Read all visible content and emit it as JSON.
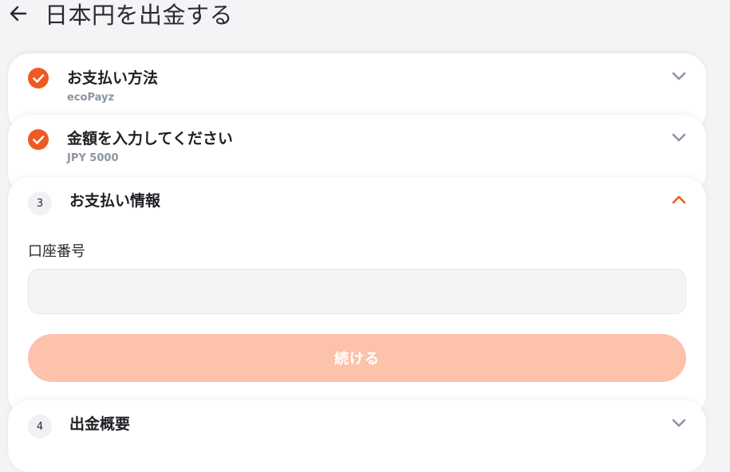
{
  "header": {
    "back_icon": "arrow-left-icon",
    "title": "日本円を出金する"
  },
  "steps": [
    {
      "status": "completed",
      "icon": "check-icon",
      "title": "お支払い方法",
      "subtitle": "ecoPayz",
      "expanded": false
    },
    {
      "status": "completed",
      "icon": "check-icon",
      "title": "金額を入力してください",
      "subtitle": "JPY 5000",
      "expanded": false
    },
    {
      "status": "active",
      "number": "3",
      "title": "お支払い情報",
      "expanded": true,
      "field_label": "口座番号",
      "field_value": "",
      "field_placeholder": "",
      "button_label": "続ける"
    },
    {
      "status": "pending",
      "number": "4",
      "title": "出金概要",
      "expanded": false
    }
  ],
  "colors": {
    "accent": "#ee5a24",
    "button_disabled": "#fdc2ab",
    "chevron_collapsed": "#8b95a1",
    "background": "#f3f4f6"
  }
}
